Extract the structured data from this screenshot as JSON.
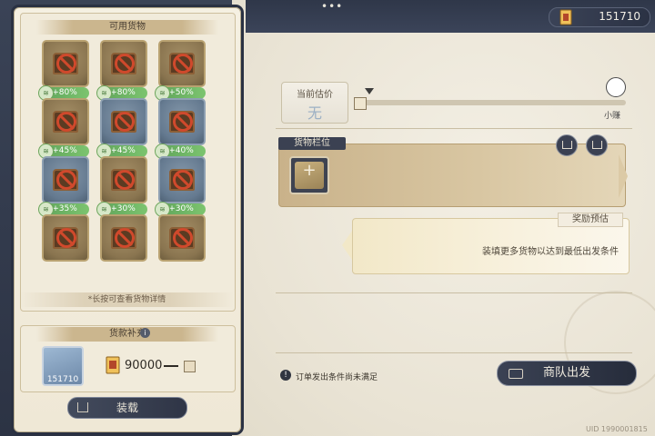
{
  "topbar": {
    "currency_amount": "151710",
    "currency_icon": "ticket-icon"
  },
  "left_panel": {
    "title": "可用货物",
    "goods": [
      {
        "bonus": "+80%",
        "style": "brown"
      },
      {
        "bonus": "+80%",
        "style": "brown"
      },
      {
        "bonus": "+50%",
        "style": "brown"
      },
      {
        "bonus": "+45%",
        "style": "brown"
      },
      {
        "bonus": "+45%",
        "style": "blue"
      },
      {
        "bonus": "+40%",
        "style": "blue"
      },
      {
        "bonus": "+35%",
        "style": "blue"
      },
      {
        "bonus": "+30%",
        "style": "brown"
      },
      {
        "bonus": "+30%",
        "style": "blue"
      },
      {
        "bonus": "",
        "style": "brown"
      },
      {
        "bonus": "",
        "style": "brown"
      },
      {
        "bonus": "",
        "style": "brown"
      }
    ],
    "hint": "*长按可查看货物详情",
    "supply": {
      "title": "货款补充",
      "card_amount": "151710",
      "price": "90000"
    },
    "load_button": "装载"
  },
  "estimate": {
    "label": "当前估价",
    "value": "无",
    "end_label": "小赚"
  },
  "slot": {
    "title": "货物栏位",
    "add_symbol": "+"
  },
  "reward": {
    "title": "奖励预估",
    "text": "装填更多货物以达到最低出发条件"
  },
  "footer": {
    "warning": "订单发出条件尚未满足",
    "depart_button": "商队出发",
    "uid": "UID 1990001815"
  }
}
